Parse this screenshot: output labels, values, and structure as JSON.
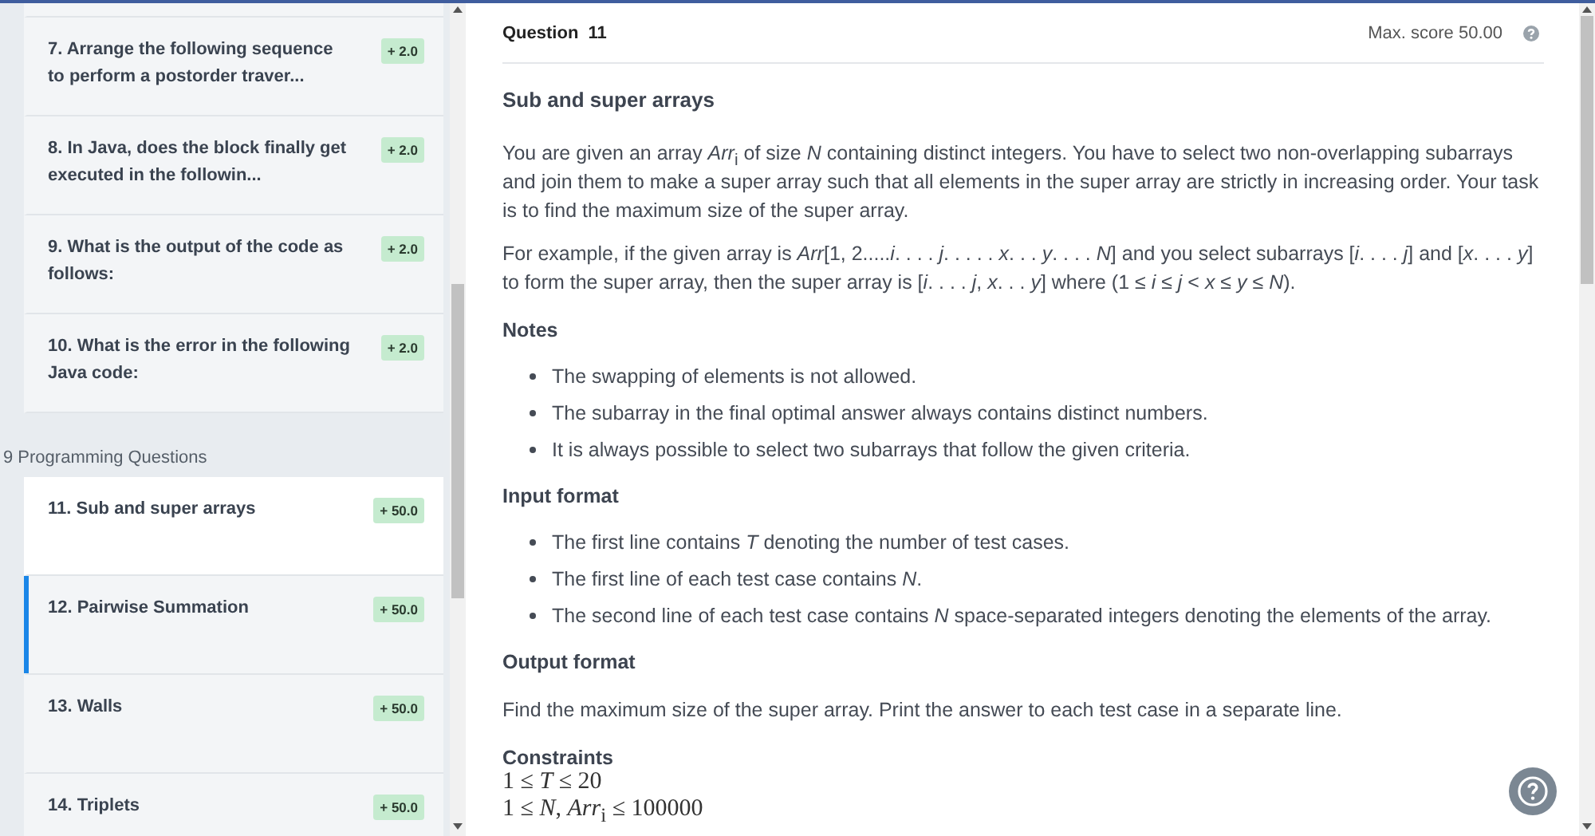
{
  "sidebar": {
    "items": [
      {
        "label": "7. Arrange the following sequence to perform a postorder traver...",
        "badge": "+ 2.0",
        "selected": false,
        "hovered": false
      },
      {
        "label": "8. In Java, does the block finally get executed in the followin...",
        "badge": "+ 2.0",
        "selected": false,
        "hovered": false
      },
      {
        "label": "9. What is the output of the code as follows:",
        "badge": "+ 2.0",
        "selected": false,
        "hovered": false
      },
      {
        "label": "10. What is the error in the following Java code:",
        "badge": "+ 2.0",
        "selected": false,
        "hovered": false
      }
    ],
    "section_title": "9 Programming Questions",
    "section_items": [
      {
        "label": "11. Sub and super arrays",
        "badge": "+ 50.0",
        "selected": false,
        "hovered": true
      },
      {
        "label": "12. Pairwise Summation",
        "badge": "+ 50.0",
        "selected": true,
        "hovered": false
      },
      {
        "label": "13. Walls",
        "badge": "+ 50.0",
        "selected": false,
        "hovered": false
      },
      {
        "label": "14. Triplets",
        "badge": "+ 50.0",
        "selected": false,
        "hovered": false
      }
    ]
  },
  "question": {
    "number_label": "Question",
    "number": "11",
    "max_score": "Max. score 50.00",
    "title": "Sub and super arrays",
    "paragraphs": [
      "You are given an array *Arr*$_{i}$ of size *N* containing distinct integers. You have to select two non-overlapping subarrays and join them to make a super array such that all elements in the super array are strictly in increasing order. Your task is to find the maximum size of the super array.",
      "For example, if the given array is *Arr*[1, 2.....*i*. . . . *j*. . . . . *x*. . . *y*. . . . *N*] and you select subarrays [*i*. . . . *j*] and [*x*. . . . *y*] to form the super array, then the super array is [*i*. . . . *j*, *x*. . . *y*] where (1 ≤ *i* ≤ *j* < *x* ≤ *y* ≤ *N*)."
    ],
    "sections": [
      {
        "heading": "Notes",
        "kind": "list",
        "lines": [
          "The swapping of elements is not allowed.",
          "The subarray in the final optimal answer always contains distinct numbers.",
          "It is always possible to select two subarrays that follow the given criteria."
        ]
      },
      {
        "heading": "Input format",
        "kind": "list",
        "lines": [
          "The first line contains *T* denoting the number of test cases.",
          "The first line of each test case contains *N*.",
          "The second line of each test case contains *N* space-separated integers denoting the elements of the array."
        ]
      },
      {
        "heading": "Output format",
        "kind": "text",
        "lines": [
          "Find the maximum size of the super array. Print the answer to each test case in a separate line."
        ]
      },
      {
        "heading": "Constraints",
        "kind": "math",
        "lines": [
          "1 ≤ *T* ≤ 20",
          "1 ≤ *N*, *Arr*$_{i}$ ≤ 100000"
        ]
      }
    ]
  }
}
